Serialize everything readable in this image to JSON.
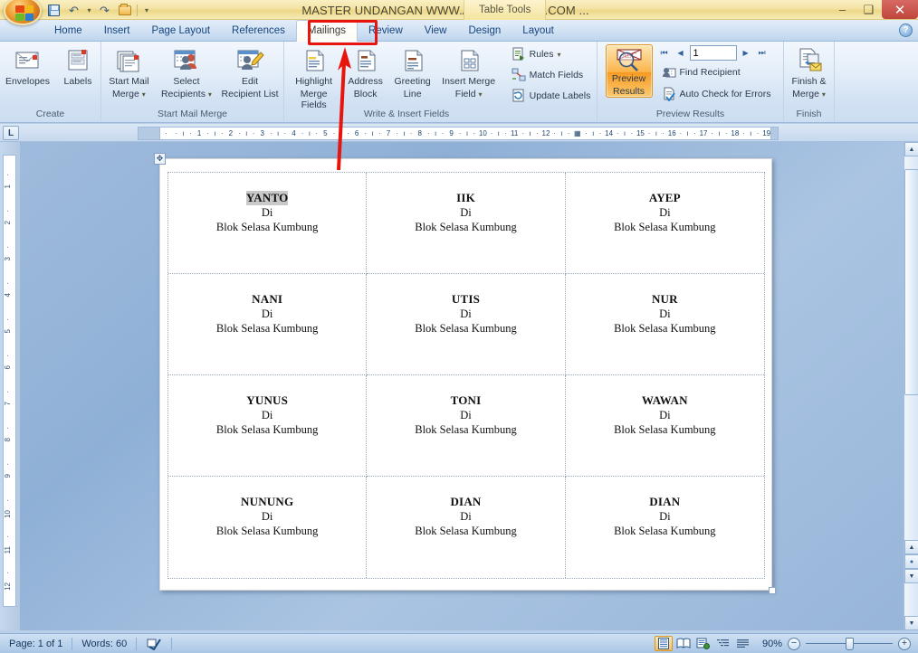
{
  "window": {
    "title": "MASTER UNDANGAN WWW.ANAKCIREMAI.COM ...",
    "contextual_tools": "Table Tools",
    "minimize": "–",
    "restore": "❐",
    "close": "✕"
  },
  "quick_access": {
    "save": "save-icon",
    "undo": "↶",
    "redo": "↷",
    "open": "open-icon",
    "customize": "▾"
  },
  "tabs": [
    {
      "label": "Home",
      "active": false
    },
    {
      "label": "Insert",
      "active": false
    },
    {
      "label": "Page Layout",
      "active": false
    },
    {
      "label": "References",
      "active": false
    },
    {
      "label": "Mailings",
      "active": true
    },
    {
      "label": "Review",
      "active": false
    },
    {
      "label": "View",
      "active": false
    },
    {
      "label": "Design",
      "active": false
    },
    {
      "label": "Layout",
      "active": false
    }
  ],
  "help_button": "?",
  "ribbon": {
    "groups": [
      {
        "name": "Create",
        "label": "Create",
        "buttons": [
          {
            "label": "Envelopes",
            "icon": "envelope-icon"
          },
          {
            "label": "Labels",
            "icon": "labels-icon"
          }
        ]
      },
      {
        "name": "Start Mail Merge",
        "label": "Start Mail Merge",
        "buttons": [
          {
            "label": "Start Mail\nMerge",
            "line1": "Start Mail",
            "line2": "Merge",
            "dropdown": true,
            "icon": "start-merge-icon"
          },
          {
            "label": "Select\nRecipients",
            "line1": "Select",
            "line2": "Recipients",
            "dropdown": true,
            "icon": "select-recipients-icon"
          },
          {
            "label": "Edit\nRecipient List",
            "line1": "Edit",
            "line2": "Recipient List",
            "dropdown": false,
            "icon": "edit-recipients-icon"
          }
        ]
      },
      {
        "name": "Write & Insert Fields",
        "label": "Write & Insert Fields",
        "buttons": [
          {
            "line1": "Highlight",
            "line2": "Merge Fields",
            "dropdown": false,
            "icon": "highlight-merge-fields-icon"
          },
          {
            "line1": "Address",
            "line2": "Block",
            "dropdown": false,
            "icon": "address-block-icon"
          },
          {
            "line1": "Greeting",
            "line2": "Line",
            "dropdown": false,
            "icon": "greeting-line-icon"
          },
          {
            "line1": "Insert Merge",
            "line2": "Field",
            "dropdown": true,
            "icon": "insert-merge-field-icon"
          }
        ],
        "small_buttons": [
          {
            "label": "Rules",
            "dropdown": true,
            "icon": "rules-icon"
          },
          {
            "label": "Match Fields",
            "dropdown": false,
            "icon": "match-fields-icon"
          },
          {
            "label": "Update Labels",
            "dropdown": false,
            "icon": "update-labels-icon"
          }
        ]
      },
      {
        "name": "Preview Results",
        "label": "Preview Results",
        "buttons": [
          {
            "line1": "Preview",
            "line2": "Results",
            "active": true,
            "icon": "preview-results-icon"
          }
        ],
        "nav": {
          "first": "⏮",
          "prev": "◀",
          "record": "1",
          "next": "▶",
          "last": "⏭"
        },
        "small_buttons": [
          {
            "label": "Find Recipient",
            "icon": "find-recipient-icon"
          },
          {
            "label": "Auto Check for Errors",
            "icon": "auto-check-errors-icon"
          }
        ]
      },
      {
        "name": "Finish",
        "label": "Finish",
        "buttons": [
          {
            "line1": "Finish &",
            "line2": "Merge",
            "dropdown": true,
            "icon": "finish-merge-icon"
          }
        ]
      }
    ]
  },
  "rulers": {
    "horizontal_ticks": [
      "1",
      "2",
      "3",
      "4",
      "5",
      "6",
      "7",
      "8",
      "9",
      "10",
      "11",
      "12",
      "",
      "14",
      "15",
      "16",
      "17",
      "18",
      "19"
    ],
    "vertical_ticks": [
      "1",
      "2",
      "3",
      "4",
      "5",
      "6",
      "7",
      "8",
      "9",
      "10",
      "11",
      "12"
    ],
    "tab_selector": "L"
  },
  "document": {
    "labels": [
      {
        "name": "YANTO",
        "di": "Di",
        "address": "Blok Selasa Kumbung",
        "selected": true
      },
      {
        "name": "IIK",
        "di": "Di",
        "address": "Blok Selasa Kumbung",
        "selected": false
      },
      {
        "name": "AYEP",
        "di": "Di",
        "address": "Blok Selasa Kumbung",
        "selected": false
      },
      {
        "name": "NANI",
        "di": "Di",
        "address": "Blok Selasa Kumbung",
        "selected": false
      },
      {
        "name": "UTIS",
        "di": "Di",
        "address": "Blok Selasa Kumbung",
        "selected": false
      },
      {
        "name": "NUR",
        "di": "Di",
        "address": "Blok Selasa Kumbung",
        "selected": false
      },
      {
        "name": "YUNUS",
        "di": "Di",
        "address": "Blok Selasa Kumbung",
        "selected": false
      },
      {
        "name": "TONI",
        "di": "Di",
        "address": "Blok Selasa Kumbung",
        "selected": false
      },
      {
        "name": "WAWAN",
        "di": "Di",
        "address": "Blok Selasa Kumbung",
        "selected": false
      },
      {
        "name": "NUNUNG",
        "di": "Di",
        "address": "Blok Selasa Kumbung",
        "selected": false
      },
      {
        "name": "DIAN",
        "di": "Di",
        "address": "Blok Selasa Kumbung",
        "selected": false
      },
      {
        "name": "DIAN",
        "di": "Di",
        "address": "Blok Selasa Kumbung",
        "selected": false
      }
    ]
  },
  "status_bar": {
    "page": "Page: 1 of 1",
    "words": "Words: 60",
    "proofing": "proofing-icon",
    "views": [
      {
        "name": "print-layout",
        "active": true
      },
      {
        "name": "full-screen-reading",
        "active": false
      },
      {
        "name": "web-layout",
        "active": false
      },
      {
        "name": "outline",
        "active": false
      },
      {
        "name": "draft",
        "active": false
      }
    ],
    "zoom": "90%",
    "zoom_out": "−",
    "zoom_in": "+"
  },
  "annotation": {
    "arrow_color": "#e8150f",
    "highlight_target": "Mailings"
  },
  "colors": {
    "accent": "#e8150f",
    "title_bg": "#f3e3a4",
    "ribbon_bg": "#dbe9f7",
    "active_btn": "#f79a22"
  }
}
